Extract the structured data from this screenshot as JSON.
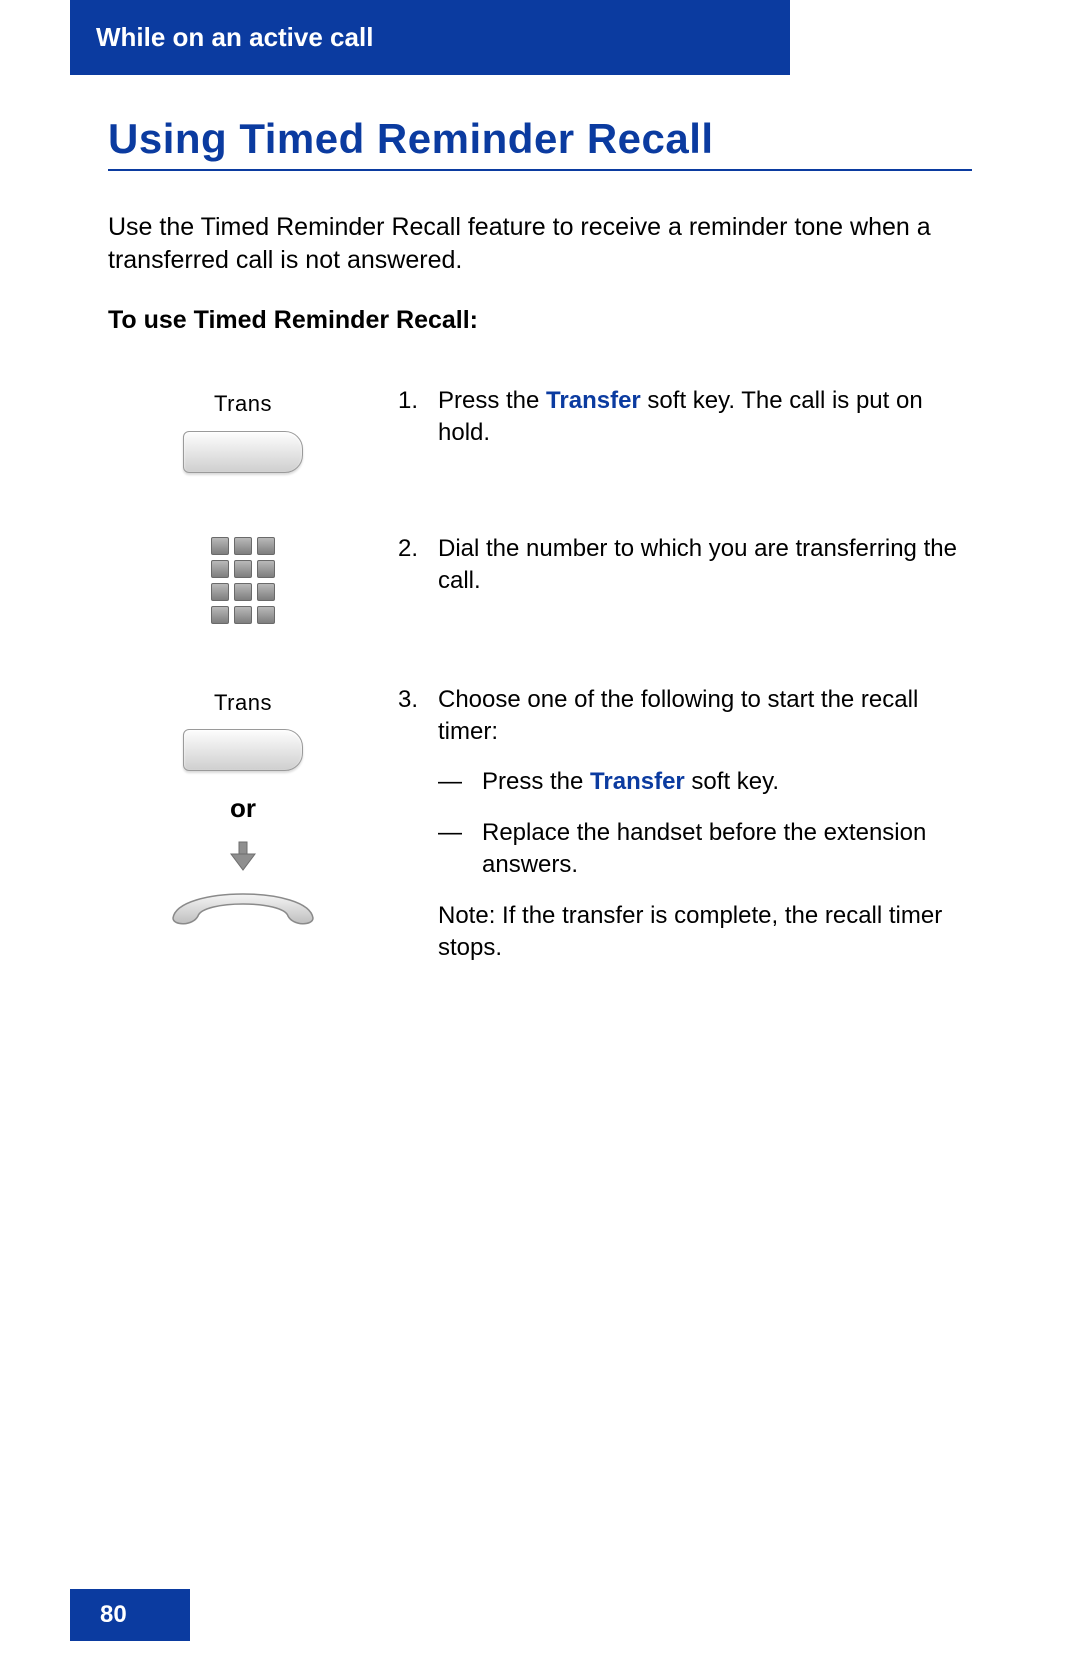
{
  "header": {
    "section_title": "While on an active call"
  },
  "title": "Using Timed Reminder Recall",
  "intro": "Use the Timed Reminder Recall feature to receive a reminder tone when a transferred call is not answered.",
  "subhead": "To use Timed Reminder Recall:",
  "softkey_label": "Trans",
  "or_label": "or",
  "steps": {
    "s1": {
      "num": "1.",
      "pre": "Press the ",
      "key": "Transfer",
      "post": " soft key. The call is put on hold."
    },
    "s2": {
      "num": "2.",
      "text": "Dial the number to which you are transferring the call."
    },
    "s3": {
      "num": "3.",
      "intro": "Choose one of the following to start the recall timer:",
      "dash": "—",
      "opt1_pre": "Press the ",
      "opt1_key": "Transfer",
      "opt1_post": " soft key.",
      "opt2": "Replace the handset before the extension answers.",
      "note": "Note: If the transfer is complete, the recall timer stops."
    }
  },
  "footer": {
    "page_number": "80"
  }
}
